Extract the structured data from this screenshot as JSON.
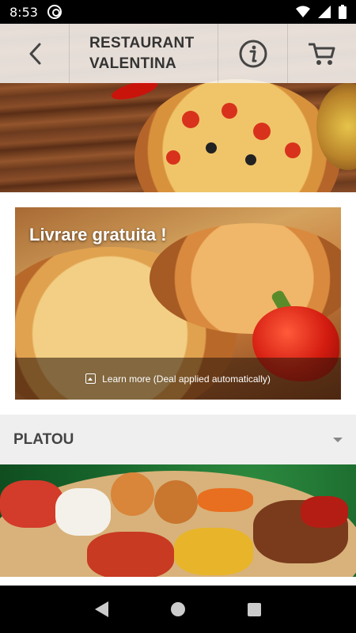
{
  "status_bar": {
    "time": "8:53"
  },
  "header": {
    "title_line1": "RESTAURANT",
    "title_line2": "VALENTINA"
  },
  "promo": {
    "title": "Livrare gratuita !",
    "footer_text": "Learn more (Deal applied automatically)"
  },
  "category": {
    "label": "PLATOU"
  },
  "colors": {
    "header_bg": "#f5f3f0",
    "category_bg": "#efefef",
    "title_text": "#333333"
  }
}
